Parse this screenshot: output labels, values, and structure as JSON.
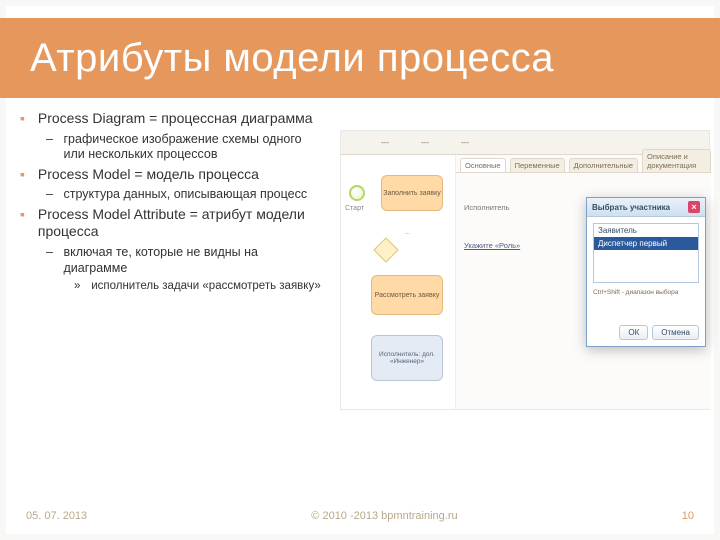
{
  "title": "Атрибуты модели процесса",
  "bullets": [
    {
      "level": 1,
      "text": "Process Diagram = процессная диаграмма",
      "children": [
        {
          "level": 2,
          "text": "графическое изображение схемы одного или нескольких процессов"
        }
      ]
    },
    {
      "level": 1,
      "text": "Process Model = модель процесса",
      "children": [
        {
          "level": 2,
          "text": "структура данных, описывающая процесс"
        }
      ]
    },
    {
      "level": 1,
      "text": "Process Model Attribute = атрибут модели процесса",
      "children": [
        {
          "level": 2,
          "text": "включая те, которые не видны на диаграмме",
          "children": [
            {
              "level": 3,
              "text": "исполнитель задачи «рассмотреть заявку»"
            }
          ]
        }
      ]
    }
  ],
  "screenshot": {
    "tabs": [
      "Основные",
      "Переменные",
      "Дополнительные",
      "Описание и документация"
    ],
    "start_label": "Старт",
    "task1": "Заполнить заявку",
    "gw_label": "...",
    "task2": "Рассмотреть заявку",
    "task3": "Исполнитель: дол. «Инженер»",
    "pane_label": "Исполнитель",
    "pane_value": "Укажите «Роль»",
    "dialog": {
      "title": "Выбрать участника",
      "opt1": "Заявитель",
      "opt2": "Диспетчер первый",
      "hint": "Ctrl+Shift - диапазон выбора",
      "ok": "ОК",
      "cancel": "Отмена"
    }
  },
  "footer": {
    "date": "05. 07. 2013",
    "copyright": "© 2010 -2013 bpmntraining.ru",
    "page": "10"
  }
}
